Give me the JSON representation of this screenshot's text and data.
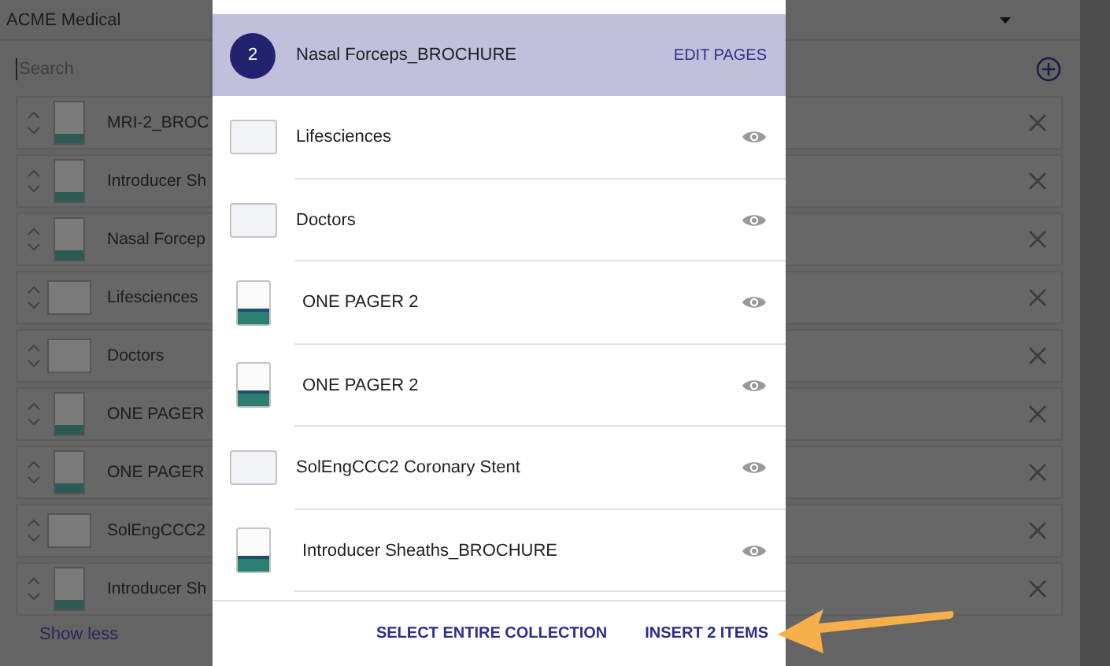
{
  "page": {
    "title": "ACME Medical",
    "search": {
      "placeholder": "Search"
    },
    "items": [
      {
        "title": "MRI-2_BROC",
        "kind": "document"
      },
      {
        "title": "Introducer Sh",
        "kind": "document"
      },
      {
        "title": "Nasal Forcep",
        "kind": "document"
      },
      {
        "title": "Lifesciences",
        "kind": "image"
      },
      {
        "title": "Doctors",
        "kind": "image"
      },
      {
        "title": "ONE PAGER",
        "kind": "document"
      },
      {
        "title": "ONE PAGER",
        "kind": "document"
      },
      {
        "title": "SolEngCCC2",
        "kind": "image"
      },
      {
        "title": "Introducer Sh",
        "kind": "document"
      }
    ],
    "show_less": "Show less"
  },
  "dialog": {
    "items": [
      {
        "title": "Nasal Forceps_BROCHURE",
        "count": "2",
        "action": "EDIT PAGES",
        "selected": true
      },
      {
        "title": "Lifesciences",
        "selected": false,
        "kind": "image"
      },
      {
        "title": "Doctors",
        "selected": false,
        "kind": "image"
      },
      {
        "title": "ONE PAGER 2",
        "selected": false,
        "kind": "document"
      },
      {
        "title": "ONE PAGER 2",
        "selected": false,
        "kind": "document"
      },
      {
        "title": "SolEngCCC2 Coronary Stent",
        "selected": false,
        "kind": "image"
      },
      {
        "title": "Introducer Sheaths_BROCHURE",
        "selected": false,
        "kind": "document"
      }
    ],
    "buttons": [
      "SELECT ENTIRE COLLECTION",
      "INSERT 2 ITEMS"
    ]
  }
}
